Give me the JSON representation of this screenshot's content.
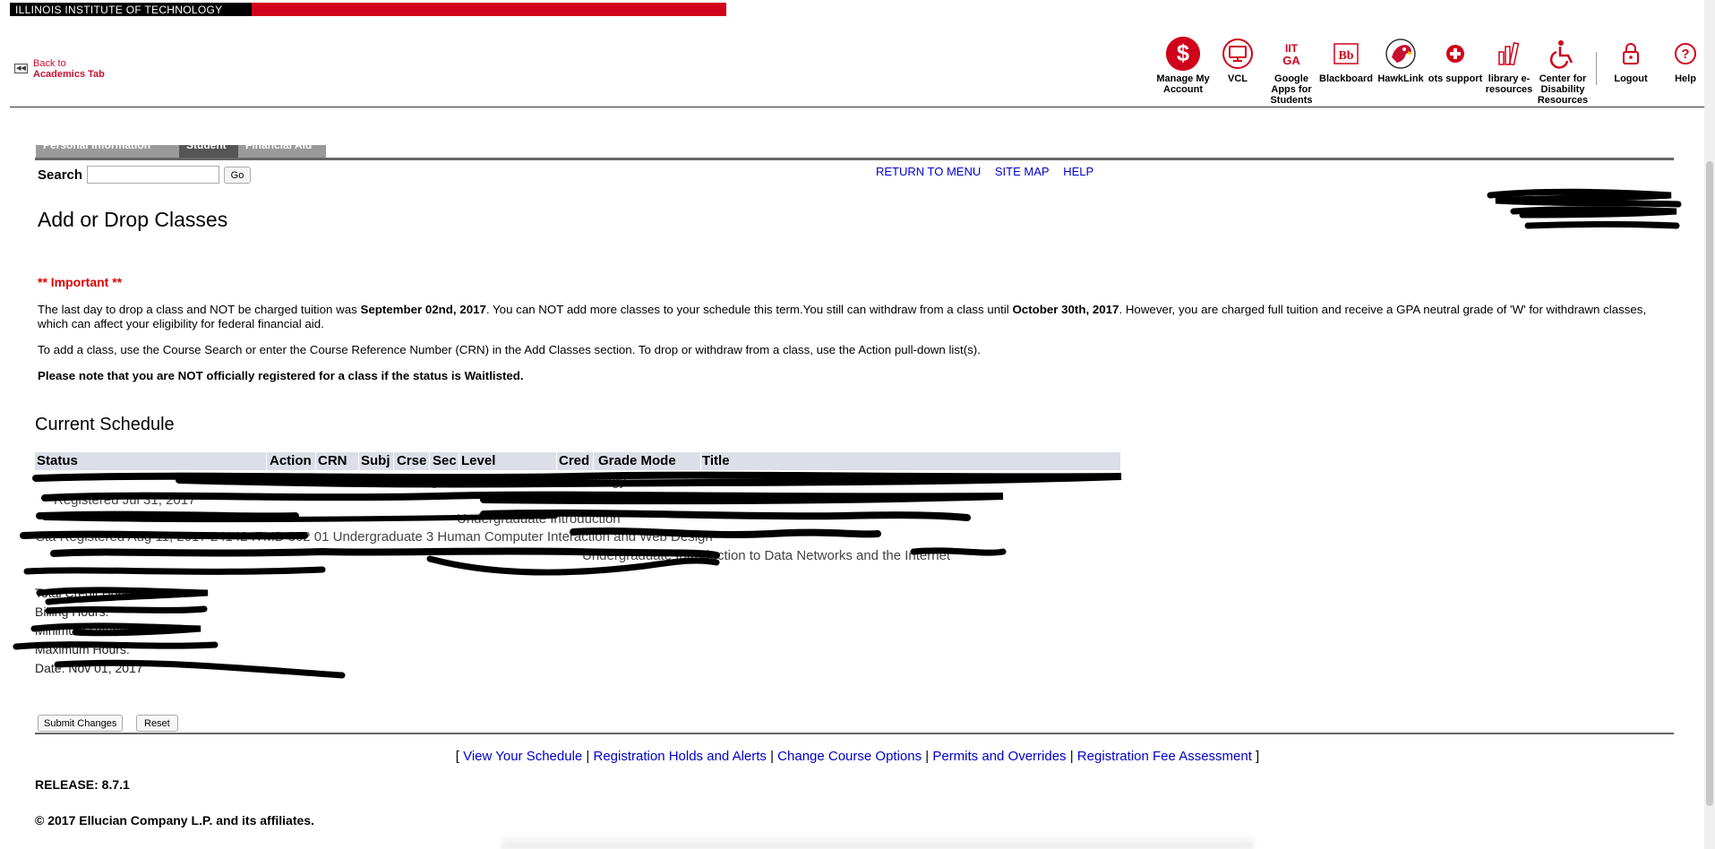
{
  "banner": {
    "label": "ILLINOIS INSTITUTE OF TECHNOLOGY"
  },
  "back_link": {
    "line1": "Back to",
    "line2": "Academics Tab"
  },
  "quick_links": [
    {
      "label": "Manage My Account",
      "icon": "dollar-icon"
    },
    {
      "label": "VCL",
      "icon": "monitor-icon"
    },
    {
      "label": "Google Apps for Students",
      "icon": "google-apps-icon"
    },
    {
      "label": "Blackboard",
      "icon": "blackboard-icon"
    },
    {
      "label": "HawkLink",
      "icon": "hawk-icon"
    },
    {
      "label": "ots support",
      "icon": "plus-icon"
    },
    {
      "label": "library e-resources",
      "icon": "books-icon"
    },
    {
      "label": "Center for Disability Resources",
      "icon": "wheelchair-icon"
    },
    {
      "label": "Logout",
      "icon": "lock-icon"
    },
    {
      "label": "Help",
      "icon": "question-icon"
    }
  ],
  "tabs": [
    "Personal Information",
    "Student",
    "Financial Aid"
  ],
  "search": {
    "label": "Search",
    "value": "",
    "go_label": "Go"
  },
  "top_links": [
    "RETURN TO MENU",
    "SITE MAP",
    "HELP"
  ],
  "page_title": "Add or Drop Classes",
  "important": {
    "heading": "** Important **",
    "p1_a": "The last day to drop a class and NOT be charged tuition was ",
    "p1_date1": "September 02nd, 2017",
    "p1_b": ". You can NOT add more classes to your schedule this term.You still can withdraw from a class until ",
    "p1_date2": "October 30th, 2017",
    "p1_c": ". However, you are charged full tuition and receive a GPA neutral grade of 'W' for withdrawn classes, which can affect your eligibility for federal financial aid.",
    "p2": "To add a class, use the Course Search or enter the Course Reference Number (CRN) in the Add Classes section. To drop or withdraw from a class, use the Action pull-down list(s).",
    "p3": "Please note that you are NOT officially registered for a class if the status is Waitlisted."
  },
  "schedule": {
    "title": "Current Schedule",
    "columns": [
      "Status",
      "Action",
      "CRN",
      "Subj",
      "Crse",
      "Sec",
      "Level",
      "Cred",
      "Grade Mode",
      "Title"
    ],
    "rows": [
      "Undergraduate  Information Technology",
      "Registered Jul 31, 2017",
      "Undergraduate  Introduction",
      "Sta  Registered Aug 11, 2017   24142 ITMD 362  01  Undergraduate 3  Human Computer Interaction and Web Design",
      "Undergraduate  Introduction to Data Networks and the Internet"
    ],
    "summary": [
      "Total Credit Hours:",
      "Billing Hours:",
      "Minimum Hours:",
      "Maximum Hours:",
      "Date:  Nov 01, 2017"
    ]
  },
  "buttons": {
    "submit": "Submit Changes",
    "reset": "Reset"
  },
  "footer_links": [
    "View Your Schedule",
    "Registration Holds and Alerts",
    "Change Course Options",
    "Permits and Overrides",
    "Registration Fee Assessment"
  ],
  "release": "RELEASE: 8.7.1",
  "copyright": "© 2017 Ellucian Company L.P. and its affiliates.",
  "colors": {
    "brand_red": "#d0021b",
    "link_blue": "#0000cc",
    "important_red": "#e00000",
    "header_bg": "#dcdee8"
  }
}
